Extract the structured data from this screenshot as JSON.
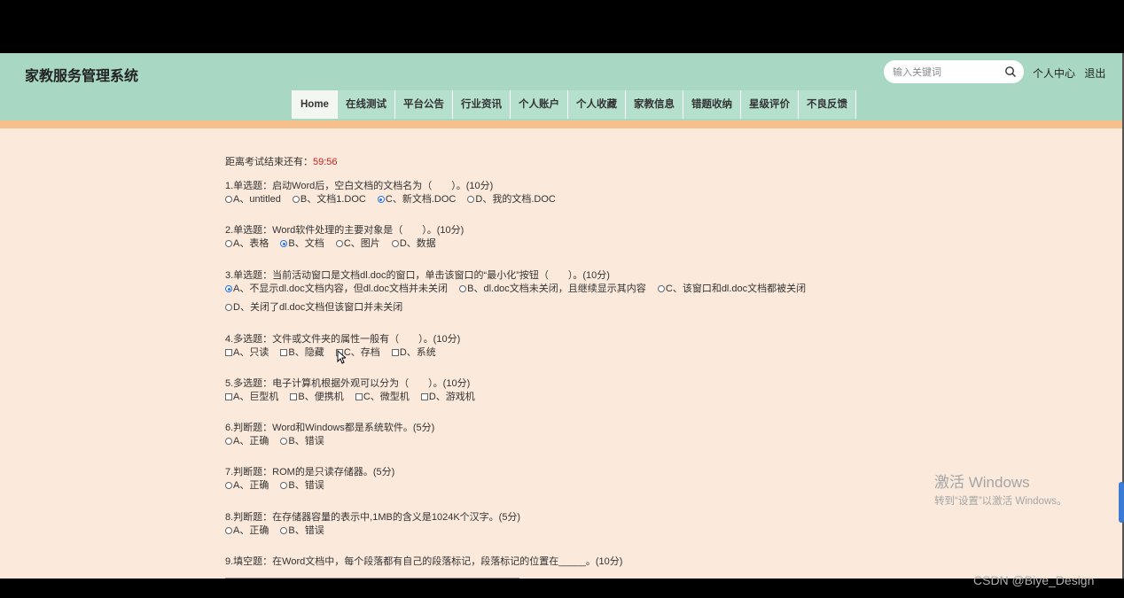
{
  "header": {
    "site_title": "家教服务管理系统",
    "search_placeholder": "输入关键词",
    "user_center": "个人中心",
    "logout": "退出"
  },
  "nav": {
    "tabs": [
      "Home",
      "在线测试",
      "平台公告",
      "行业资讯",
      "个人账户",
      "个人收藏",
      "家教信息",
      "错题收纳",
      "星级评价",
      "不良反馈"
    ]
  },
  "exam": {
    "timer_label": "距离考试结束还有：",
    "timer_value": "59:56",
    "questions": [
      {
        "title": "1.单选题：启动Word后，空白文档的文档名为（　　）。(10分)",
        "options": [
          "A、untitled",
          "B、文档1.DOC",
          "C、新文档.DOC",
          "D、我的文档.DOC"
        ]
      },
      {
        "title": "2.单选题：Word软件处理的主要对象是（　　）。(10分)",
        "options": [
          "A、表格",
          "B、文档",
          "C、图片",
          "D、数据"
        ]
      },
      {
        "title": "3.单选题：当前活动窗口是文档dl.doc的窗口，单击该窗口的“最小化”按钮（　　）。(10分)",
        "options": [
          "A、不显示dl.doc文档内容，但dl.doc文档并未关闭",
          "B、dl.doc文档未关闭，且继续显示其内容",
          "C、该窗口和dl.doc文档都被关闭"
        ],
        "options2": [
          "D、关闭了dl.doc文档但该窗口并未关闭"
        ]
      },
      {
        "title": "4.多选题：文件或文件夹的属性一般有（　　）。(10分)",
        "options": [
          "A、只读",
          "B、隐藏",
          "C、存档",
          "D、系统"
        ]
      },
      {
        "title": "5.多选题：电子计算机根据外观可以分为（　　）。(10分)",
        "options": [
          "A、巨型机",
          "B、便携机",
          "C、微型机",
          "D、游戏机"
        ]
      },
      {
        "title": "6.判断题：Word和Windows都是系统软件。(5分)",
        "options": [
          "A、正确",
          "B、错误"
        ]
      },
      {
        "title": "7.判断题：ROM的是只读存储器。(5分)",
        "options": [
          "A、正确",
          "B、错误"
        ]
      },
      {
        "title": "8.判断题：在存储器容量的表示中,1MB的含义是1024K个汉字。(5分)",
        "options": [
          "A、正确",
          "B、错误"
        ]
      },
      {
        "title": "9.填空题：在Word文档中，每个段落都有自己的段落标记，段落标记的位置在_____。(10分)"
      }
    ],
    "selected": {
      "q1": "C",
      "q2": "B",
      "q3": "A"
    }
  },
  "overlay": {
    "watermark_line1": "激活 Windows",
    "watermark_line2": "转到“设置”以激活 Windows。",
    "credit": "CSDN @Biye_Design"
  },
  "colors": {
    "header_bg": "#a8d8c3",
    "accent_stripe": "#f6bf8c",
    "page_bg": "#fbe9db",
    "timer_color": "#cc2222"
  }
}
